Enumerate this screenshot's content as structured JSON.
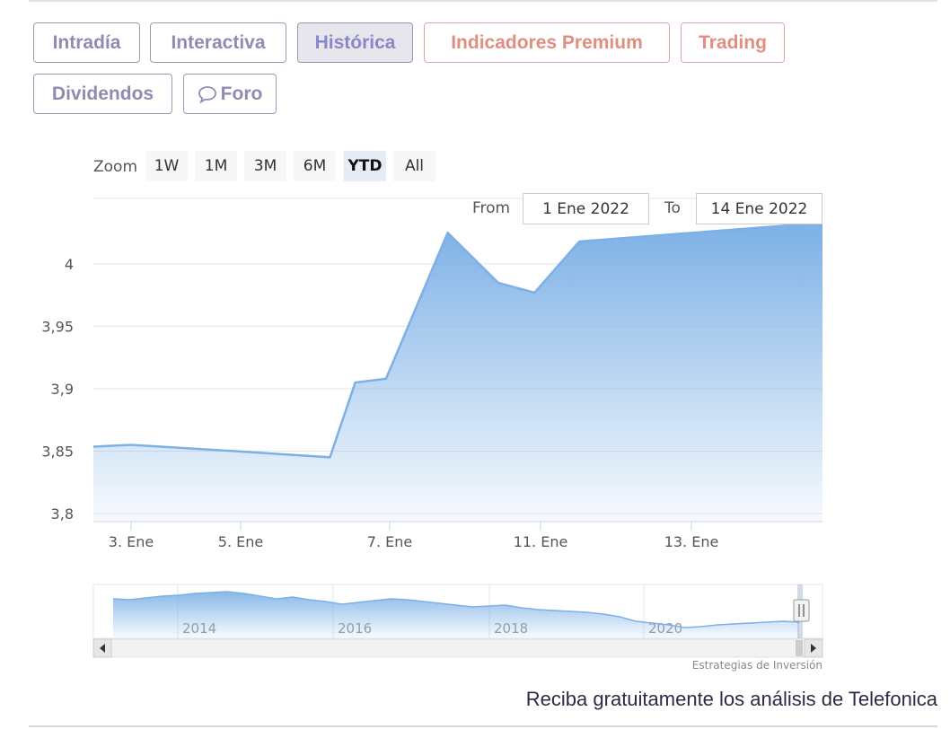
{
  "tabs": [
    {
      "label": "Intradía",
      "style": "normal"
    },
    {
      "label": "Interactiva",
      "style": "normal"
    },
    {
      "label": "Histórica",
      "style": "active"
    },
    {
      "label": "Indicadores Premium",
      "style": "premium"
    },
    {
      "label": "Trading",
      "style": "premium"
    },
    {
      "label": "Dividendos",
      "style": "normal"
    },
    {
      "label": "Foro",
      "style": "normal",
      "icon": "speech-bubble-icon"
    }
  ],
  "zoom": {
    "label": "Zoom",
    "buttons": [
      "1W",
      "1M",
      "3M",
      "6M",
      "YTD",
      "All"
    ],
    "active": "YTD"
  },
  "range": {
    "from_label": "From",
    "from_value": "1 Ene 2022",
    "to_label": "To",
    "to_value": "14 Ene 2022"
  },
  "credits": "Estrategias de Inversión",
  "cta": "Reciba gratuitamente los análisis de Telefonica",
  "colors": {
    "series_line": "#7cb0e6",
    "series_fill_top": "#7cb0e6",
    "tab_border": "#9d9bb8",
    "tab_text": "#8f8caf",
    "premium": "#e08e80",
    "active_tab_bg": "#e6e6ec"
  },
  "chart_data": [
    {
      "type": "area",
      "x_dates": [
        "2022-01-02",
        "2022-01-03",
        "2022-01-04",
        "2022-01-05",
        "2022-01-06",
        "2022-01-07",
        "2022-01-08",
        "2022-01-10",
        "2022-01-11",
        "2022-01-12",
        "2022-01-12T12",
        "2022-01-13",
        "2022-01-14"
      ],
      "x_tick_labels": [
        "3. Ene",
        "5. Ene",
        "7. Ene",
        "11. Ene",
        "13. Ene"
      ],
      "values": [
        3.853,
        3.855,
        3.85,
        3.845,
        3.905,
        3.908,
        4.025,
        3.985,
        3.977,
        4.018,
        4.033
      ],
      "y_ticks": [
        "3,8",
        "3,85",
        "3,9",
        "3,95",
        "4"
      ],
      "ylim": [
        3.8,
        4.05
      ]
    },
    {
      "type": "area",
      "role": "navigator",
      "x_tick_labels": [
        "2014",
        "2016",
        "2018",
        "2020"
      ],
      "values": [
        3.6,
        3.5,
        3.7,
        3.9,
        4.0,
        4.2,
        4.3,
        4.4,
        4.2,
        3.9,
        3.6,
        3.8,
        3.5,
        3.3,
        3.0,
        3.2,
        3.4,
        3.6,
        3.5,
        3.3,
        3.1,
        2.9,
        2.7,
        2.8,
        2.9,
        2.6,
        2.4,
        2.3,
        2.2,
        2.1,
        1.9,
        1.6,
        1.1,
        0.9,
        0.7,
        0.4,
        0.5,
        0.7,
        0.8,
        0.9,
        1.0,
        1.1,
        1.0
      ]
    }
  ]
}
